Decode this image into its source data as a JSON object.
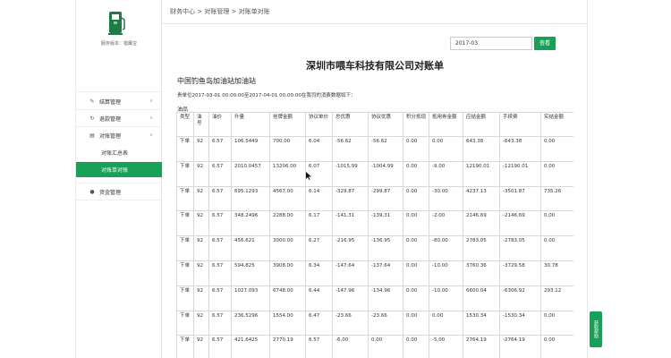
{
  "sidebar": {
    "version_label": "服务版本：猎鹰宝",
    "items": [
      {
        "label": "结算管理",
        "icon": "edit-icon",
        "chevron": "∨"
      },
      {
        "label": "退款管理",
        "icon": "refund-icon",
        "chevron": "∨"
      },
      {
        "label": "对账管理",
        "icon": "clipboard-icon",
        "chevron": "∧"
      },
      {
        "label": "资金管理",
        "icon": "money-bag-icon",
        "chevron": ""
      }
    ],
    "sub_items": [
      {
        "label": "对账汇总表"
      },
      {
        "label": "对账单对账"
      }
    ]
  },
  "breadcrumb": "财务中心 > 对账管理 > 对账单对账",
  "search": {
    "date_value": "2017-03",
    "button_label": "查看"
  },
  "report": {
    "title": "深圳市喂车科技有限公司对账单",
    "station": "中国钓鱼岛加油站加油站",
    "description": "贵单位2017-03-01 00:00:00至2017-04-01 00:00:00在我司的消费数据如下：",
    "category": "油品"
  },
  "table": {
    "headers": [
      "类型",
      "油号",
      "油价",
      "升量",
      "挂牌金额",
      "协议单价",
      "总优惠",
      "协议优惠",
      "积分抵现",
      "抵用券金额",
      "应结金额",
      "手续费",
      "实结金额"
    ],
    "rows": [
      [
        "下单",
        "92",
        "6.57",
        "106.5449",
        "700.00",
        "6.04",
        "-56.62",
        "-56.62",
        "0.00",
        "0.00",
        "643.38",
        "-643.38",
        "0.00"
      ],
      [
        "下单",
        "92",
        "6.57",
        "2010.0457",
        "13206.00",
        "6.07",
        "-1015.99",
        "-1004.99",
        "0.00",
        "-9.00",
        "12190.01",
        "-12190.01",
        "0.00"
      ],
      [
        "下单",
        "92",
        "6.57",
        "695.1293",
        "4567.00",
        "6.14",
        "-329.87",
        "-299.87",
        "0.00",
        "-30.00",
        "4237.13",
        "-3501.87",
        "735.26"
      ],
      [
        "下单",
        "92",
        "6.57",
        "348.2496",
        "2288.00",
        "6.17",
        "-141.31",
        "-139.31",
        "0.00",
        "-2.00",
        "2146.69",
        "-2146.69",
        "0.00"
      ],
      [
        "下单",
        "92",
        "6.57",
        "456.621",
        "3000.00",
        "6.27",
        "-216.95",
        "-136.95",
        "0.00",
        "-80.00",
        "2783.05",
        "-2783.05",
        "0.00"
      ],
      [
        "下单",
        "92",
        "6.57",
        "594.825",
        "3908.00",
        "6.34",
        "-147.64",
        "-137.64",
        "0.00",
        "-10.00",
        "3760.36",
        "-3729.58",
        "30.78"
      ],
      [
        "下单",
        "92",
        "6.57",
        "1027.093",
        "6748.00",
        "6.44",
        "-147.96",
        "-134.96",
        "0.00",
        "-10.00",
        "6600.04",
        "-6306.92",
        "293.12"
      ],
      [
        "下单",
        "92",
        "6.57",
        "236.5296",
        "1554.00",
        "6.47",
        "-23.66",
        "-23.66",
        "0.00",
        "0.00",
        "1530.34",
        "-1530.34",
        "0.00"
      ],
      [
        "下单",
        "92",
        "6.57",
        "421.6425",
        "2770.19",
        "6.57",
        "-6.00",
        "0.00",
        "0.00",
        "-5.00",
        "2764.19",
        "-2764.19",
        "0.00"
      ]
    ]
  },
  "float_tab_label": "获取帮助",
  "colors": {
    "accent": "#18a056"
  }
}
